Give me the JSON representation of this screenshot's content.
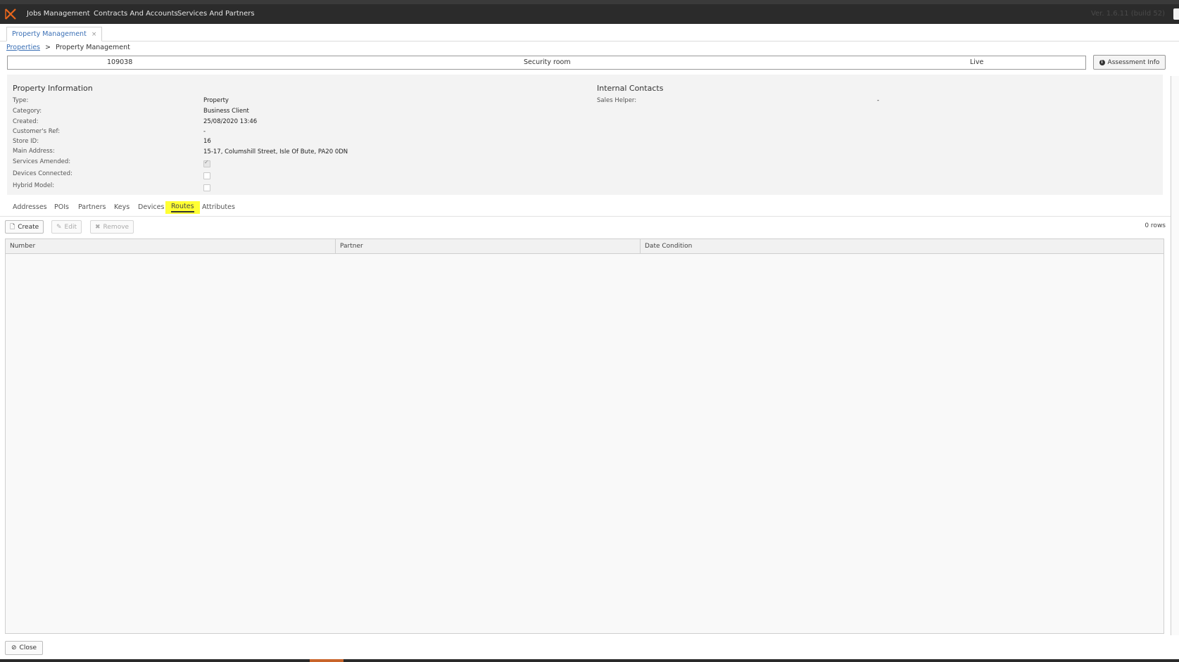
{
  "topnav": {
    "items": [
      "Jobs Management",
      "Contracts And Accounts",
      "Services And Partners"
    ],
    "version": "Ver. 1.6.11 (build 52)",
    "logo_color": "#e8661c"
  },
  "tabs": {
    "active": "Property Management",
    "close": "×"
  },
  "breadcrumb": {
    "link": "Properties",
    "separator": ">",
    "current": "Property Management"
  },
  "summary": {
    "id": "109038",
    "name": "Security room",
    "status": "Live",
    "assessment_btn": "Assessment Info"
  },
  "property_info": {
    "title": "Property Information",
    "type_label": "Type:",
    "type_value": "Property",
    "category_label": "Category:",
    "category_value": "Business Client",
    "created_label": "Created:",
    "created_value": "25/08/2020 13:46",
    "customer_ref_label": "Customer's Ref:",
    "customer_ref_value": "-",
    "store_id_label": "Store ID:",
    "store_id_value": "16",
    "address_label": "Main Address:",
    "address_value": "15-17, Columshill Street, Isle Of Bute, PA20 0DN",
    "services_amended_label": "Services Amended:",
    "services_amended": true,
    "devices_connected_label": "Devices Connected:",
    "devices_connected": false,
    "hybrid_model_label": "Hybrid Model:",
    "hybrid_model": false
  },
  "internal_contacts": {
    "title": "Internal Contacts",
    "sales_helper_label": "Sales Helper:",
    "sales_helper_value": "-"
  },
  "subtabs": [
    "Addresses",
    "POIs",
    "Partners",
    "Keys",
    "Devices",
    "Routes",
    "Attributes"
  ],
  "active_subtab": "Routes",
  "toolbar": {
    "create": "Create",
    "edit": "Edit",
    "remove": "Remove",
    "rows": "0 rows"
  },
  "grid": {
    "columns": [
      "Number",
      "Partner",
      "Date Condition"
    ]
  },
  "footer": {
    "close": "Close"
  }
}
